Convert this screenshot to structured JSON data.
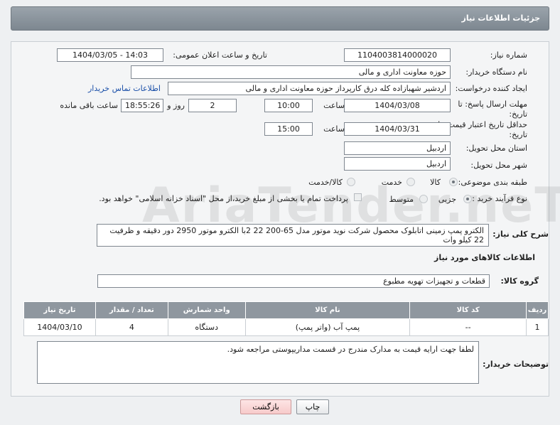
{
  "header": {
    "title": "جزئیات اطلاعات نیاز"
  },
  "form": {
    "need_number": {
      "label": "شماره نیاز:",
      "value": "1104003814000020"
    },
    "announce": {
      "label": "تاریخ و ساعت اعلان عمومی:",
      "value": "1404/03/05 - 14:03"
    },
    "buyer": {
      "label": "نام دستگاه خریدار:",
      "value": "حوزه معاونت اداری و مالی"
    },
    "creator": {
      "label": "ایجاد کننده درخواست:",
      "value": "اردشیر شهبازاده کله درق کارپرداز حوزه معاونت اداری و مالی",
      "contact_link": "اطلاعات تماس خریدار"
    },
    "deadline": {
      "label": "مهلت ارسال پاسخ: تا تاریخ:",
      "date": "1404/03/08",
      "time_label": "ساعت",
      "time": "10:00",
      "days": "2",
      "days_label": "روز و",
      "remaining": "18:55:26",
      "remaining_label": "ساعت باقی مانده"
    },
    "validity": {
      "label": "حداقل تاریخ اعتبار قیمت: تا تاریخ:",
      "date": "1404/03/31",
      "time_label": "ساعت",
      "time": "15:00"
    },
    "province": {
      "label": "استان محل تحویل:",
      "value": "اردبیل"
    },
    "city": {
      "label": "شهر محل تحویل:",
      "value": "اردبیل"
    },
    "category": {
      "label": "طبقه بندی موضوعی:",
      "options": [
        "کالا",
        "خدمت",
        "کالا/خدمت"
      ]
    },
    "process": {
      "label": "نوع فرآیند خرید :",
      "options": [
        "جزیی",
        "متوسط"
      ],
      "note": "پرداخت تمام یا بخشی از مبلغ خرید،از محل \"اسناد خزانه اسلامی\" خواهد بود."
    },
    "description": {
      "label": "شرح کلی نیاز:",
      "value": "الکترو پمپ زمینی اتابلوک محصول شرکت نوید موتور مدل  65-200 22 2با الکترو موتور 2950 دور دقیقه و ظرفیت 22 کیلو وات"
    }
  },
  "goods": {
    "section_title": "اطلاعات کالاهای مورد نیاز",
    "group_label": "گروه کالا:",
    "group_value": "قطعات و تجهیزات تهویه مطبوع",
    "columns": [
      "ردیف",
      "کد کالا",
      "نام کالا",
      "واحد شمارش",
      "تعداد / مقدار",
      "تاریخ نیاز"
    ],
    "rows": [
      {
        "row": "1",
        "code": "--",
        "name": "پمپ آب (واتر پمپ)",
        "unit": "دستگاه",
        "qty": "4",
        "date": "1404/03/10"
      }
    ]
  },
  "notes": {
    "label": "توضیحات خریدار:",
    "value": "لطفا جهت ارایه قیمت به مدارک مندرج در قسمت مداریپوستی مراجعه شود."
  },
  "buttons": {
    "print": "چاپ",
    "back": "بازگشت"
  },
  "watermark": {
    "text": "AriaTender.neT"
  }
}
